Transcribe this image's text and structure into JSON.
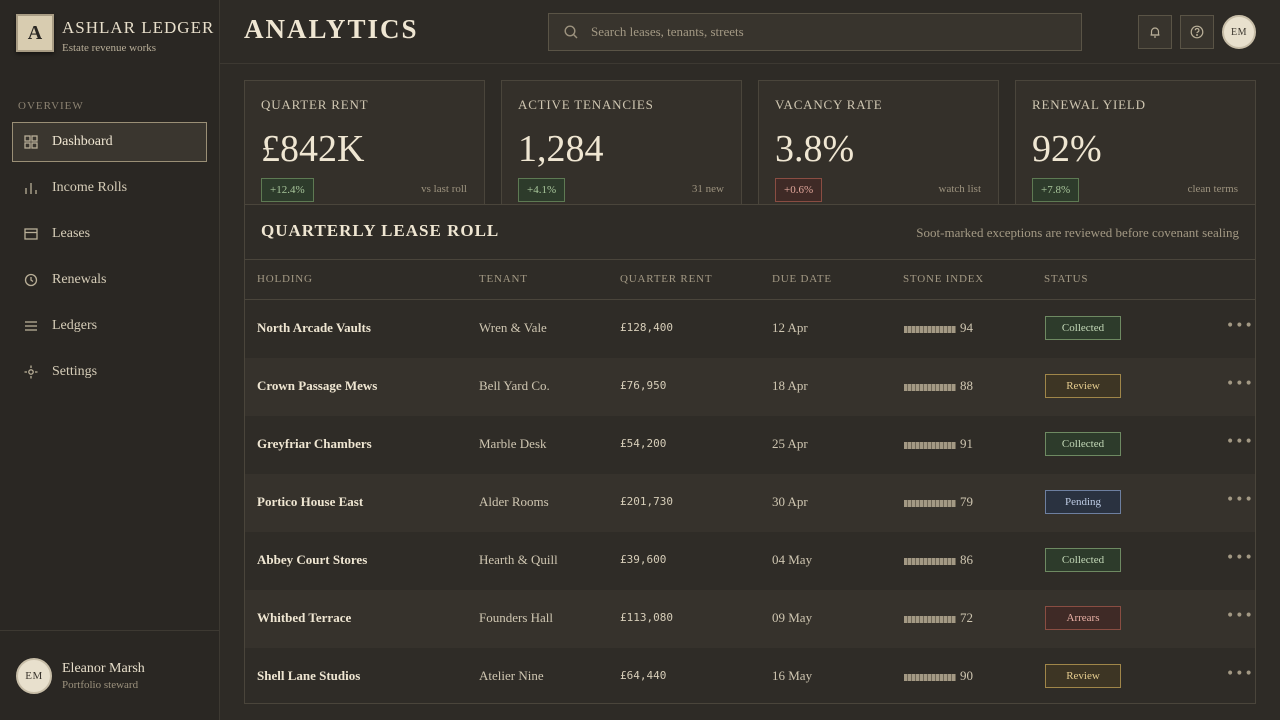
{
  "brand": {
    "mark": "A",
    "title": "ASHLAR LEDGER",
    "subtitle": "Estate revenue works"
  },
  "sidebar": {
    "section": "OVERVIEW",
    "items": [
      {
        "label": "Dashboard",
        "icon": "grid-icon",
        "active": true
      },
      {
        "label": "Income Rolls",
        "icon": "bar-chart-icon"
      },
      {
        "label": "Leases",
        "icon": "card-icon"
      },
      {
        "label": "Renewals",
        "icon": "clock-icon"
      },
      {
        "label": "Ledgers",
        "icon": "list-icon"
      },
      {
        "label": "Settings",
        "icon": "gear-icon"
      }
    ],
    "user": {
      "initials": "EM",
      "name": "Eleanor Marsh",
      "role": "Portfolio steward"
    }
  },
  "header": {
    "title": "ANALYTICS",
    "search_placeholder": "Search leases, tenants, streets",
    "avatar_initials": "EM"
  },
  "stats": [
    {
      "label": "QUARTER RENT",
      "value": "£842K",
      "delta": "+12.4%",
      "trend": "up",
      "note": "vs last roll"
    },
    {
      "label": "ACTIVE TENANCIES",
      "value": "1,284",
      "delta": "+4.1%",
      "trend": "up",
      "note": "31 new"
    },
    {
      "label": "VACANCY RATE",
      "value": "3.8%",
      "delta": "+0.6%",
      "trend": "down",
      "note": "watch list"
    },
    {
      "label": "RENEWAL YIELD",
      "value": "92%",
      "delta": "+7.8%",
      "trend": "up",
      "note": "clean terms"
    }
  ],
  "table": {
    "title": "QUARTERLY LEASE ROLL",
    "note": "Soot-marked exceptions are reviewed before covenant sealing",
    "columns": [
      "HOLDING",
      "TENANT",
      "QUARTER RENT",
      "DUE DATE",
      "STONE INDEX",
      "STATUS"
    ],
    "rows": [
      {
        "holding": "North Arcade Vaults",
        "tenant": "Wren & Vale",
        "rent": "£128,400",
        "due": "12 Apr",
        "index": "94",
        "status": "Collected"
      },
      {
        "holding": "Crown Passage Mews",
        "tenant": "Bell Yard Co.",
        "rent": "£76,950",
        "due": "18 Apr",
        "index": "88",
        "status": "Review"
      },
      {
        "holding": "Greyfriar Chambers",
        "tenant": "Marble Desk",
        "rent": "£54,200",
        "due": "25 Apr",
        "index": "91",
        "status": "Collected"
      },
      {
        "holding": "Portico House East",
        "tenant": "Alder Rooms",
        "rent": "£201,730",
        "due": "30 Apr",
        "index": "79",
        "status": "Pending"
      },
      {
        "holding": "Abbey Court Stores",
        "tenant": "Hearth & Quill",
        "rent": "£39,600",
        "due": "04 May",
        "index": "86",
        "status": "Collected"
      },
      {
        "holding": "Whitbed Terrace",
        "tenant": "Founders Hall",
        "rent": "£113,080",
        "due": "09 May",
        "index": "72",
        "status": "Arrears"
      },
      {
        "holding": "Shell Lane Studios",
        "tenant": "Atelier Nine",
        "rent": "£64,440",
        "due": "16 May",
        "index": "90",
        "status": "Review"
      }
    ]
  }
}
